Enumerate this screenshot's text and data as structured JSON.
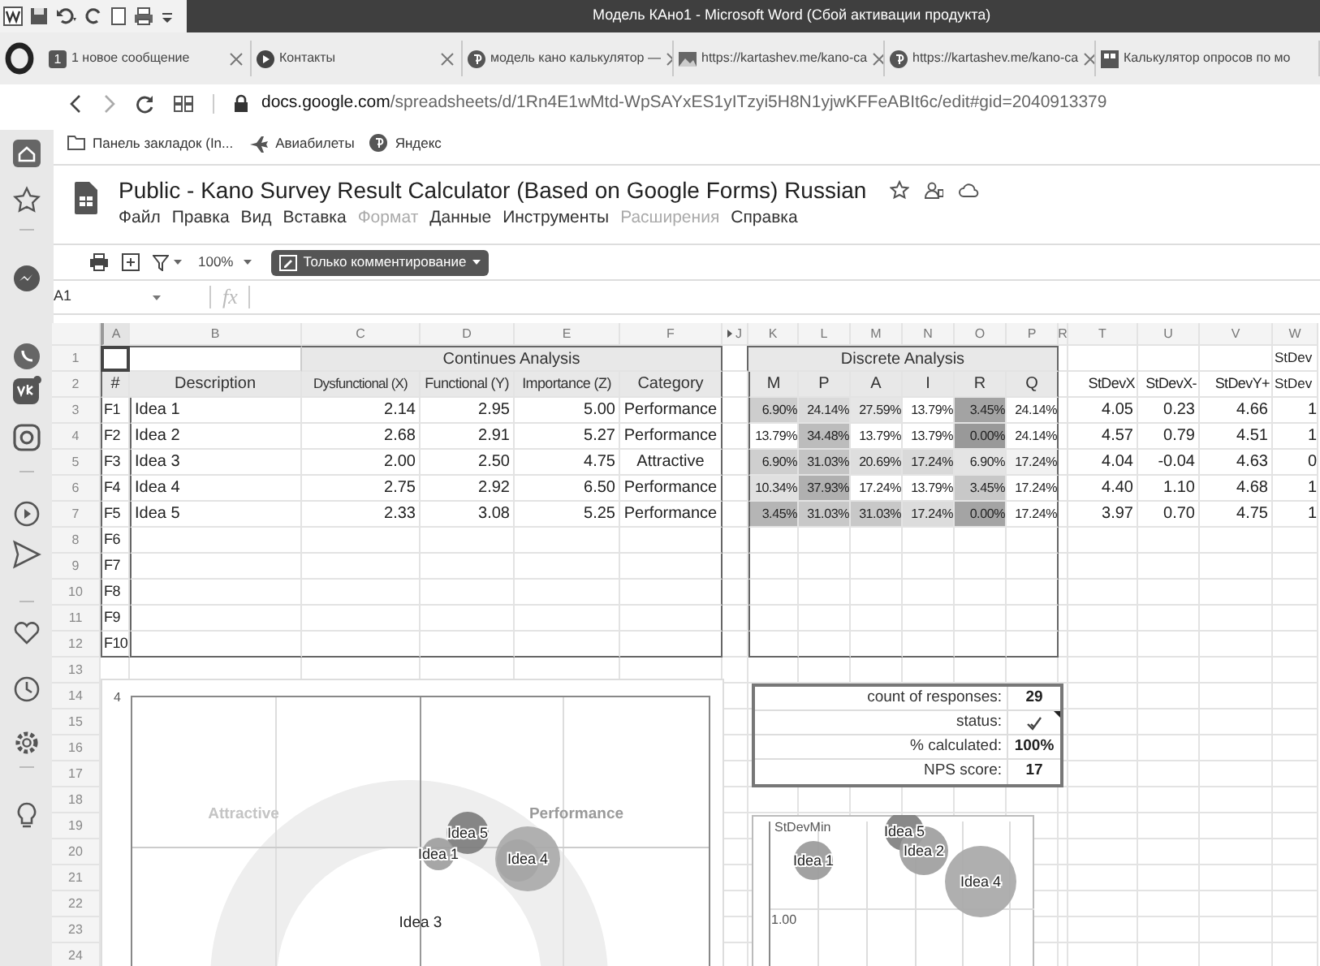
{
  "word": {
    "title": "Модель КАно1  -  Microsoft Word (Сбой активации продукта)"
  },
  "browser": {
    "tabs": [
      {
        "badge": "1",
        "label": "1 новое сообщение"
      },
      {
        "label": "Контакты"
      },
      {
        "label": "модель кано калькулятор —"
      },
      {
        "label": "https://kartashev.me/kano-ca"
      },
      {
        "label": "https://kartashev.me/kano-ca"
      },
      {
        "label": "Калькулятор опросов по мо"
      }
    ],
    "url": {
      "host": "docs.google.com",
      "path": "/spreadsheets/d/1Rn4E1wMtd-WpSAYxES1yITzyi5H8N1yjwKFFeABIt6c/edit#gid=2040913379"
    },
    "bookmarks": [
      "Панель закладок (In...",
      "Авиабилеты",
      "Яндекс"
    ]
  },
  "doc": {
    "title": "Public - Kano Survey Result Calculator (Based on Google Forms) Russian",
    "menu": [
      {
        "label": "Файл",
        "disabled": false
      },
      {
        "label": "Правка",
        "disabled": false
      },
      {
        "label": "Вид",
        "disabled": false
      },
      {
        "label": "Вставка",
        "disabled": false
      },
      {
        "label": "Формат",
        "disabled": true
      },
      {
        "label": "Данные",
        "disabled": false
      },
      {
        "label": "Инструменты",
        "disabled": false
      },
      {
        "label": "Расширения",
        "disabled": true
      },
      {
        "label": "Справка",
        "disabled": false
      }
    ],
    "zoom": "100%",
    "mode": "Только комментирование",
    "name_box": "A1",
    "fx": "fx"
  },
  "sheet": {
    "columns": [
      "A",
      "B",
      "C",
      "D",
      "E",
      "F",
      "J",
      "K",
      "L",
      "M",
      "N",
      "O",
      "P",
      "R",
      "T",
      "U",
      "V",
      "W"
    ],
    "row_numbers": [
      "1",
      "2",
      "3",
      "4",
      "5",
      "6",
      "7",
      "8",
      "9",
      "10",
      "11",
      "12",
      "13",
      "14",
      "15",
      "16",
      "17",
      "18",
      "19",
      "20",
      "21",
      "22",
      "23",
      "24"
    ],
    "continuous": {
      "title": "Continues Analysis",
      "headers": [
        "#",
        "Description",
        "Dysfunctional (X)",
        "Functional (Y)",
        "Importance (Z)",
        "Category"
      ],
      "rows": [
        {
          "id": "F1",
          "cells": [
            "Idea 1",
            "2.14",
            "2.95",
            "5.00",
            "Performance"
          ]
        },
        {
          "id": "F2",
          "cells": [
            "Idea 2",
            "2.68",
            "2.91",
            "5.27",
            "Performance"
          ]
        },
        {
          "id": "F3",
          "cells": [
            "Idea 3",
            "2.00",
            "2.50",
            "4.75",
            "Attractive"
          ]
        },
        {
          "id": "F4",
          "cells": [
            "Idea 4",
            "2.75",
            "2.92",
            "6.50",
            "Performance"
          ]
        },
        {
          "id": "F5",
          "cells": [
            "Idea 5",
            "2.33",
            "3.08",
            "5.25",
            "Performance"
          ]
        },
        {
          "id": "F6"
        },
        {
          "id": "F7"
        },
        {
          "id": "F8"
        },
        {
          "id": "F9"
        },
        {
          "id": "F10"
        }
      ]
    },
    "discrete": {
      "title": "Discrete Analysis",
      "headers": [
        "M",
        "P",
        "A",
        "I",
        "R",
        "Q"
      ],
      "rows": [
        [
          {
            "text": "6.90%",
            "color": "#cdcdcd"
          },
          {
            "text": "24.14%",
            "color": "#dadada"
          },
          {
            "text": "27.59%",
            "color": "#e6e6e6"
          },
          {
            "text": "13.79%",
            "color": "#ffffff"
          },
          {
            "text": "3.45%",
            "color": "#a3a3a3"
          },
          {
            "text": "24.14%",
            "color": "#ffffff"
          }
        ],
        [
          {
            "text": "13.79%",
            "color": "#ffffff"
          },
          {
            "text": "34.48%",
            "color": "#bcbcbc"
          },
          {
            "text": "13.79%",
            "color": "#ffffff"
          },
          {
            "text": "13.79%",
            "color": "#ffffff"
          },
          {
            "text": "0.00%",
            "color": "#999999"
          },
          {
            "text": "24.14%",
            "color": "#ffffff"
          }
        ],
        [
          {
            "text": "6.90%",
            "color": "#cfcfcf"
          },
          {
            "text": "31.03%",
            "color": "#c4c4c4"
          },
          {
            "text": "20.69%",
            "color": "#dedede"
          },
          {
            "text": "17.24%",
            "color": "#d9d9d9"
          },
          {
            "text": "6.90%",
            "color": "#e4e4e4"
          },
          {
            "text": "17.24%",
            "color": "#f2f2f2"
          }
        ],
        [
          {
            "text": "10.34%",
            "color": "#e0e0e0"
          },
          {
            "text": "37.93%",
            "color": "#b0b0b0"
          },
          {
            "text": "17.24%",
            "color": "#ffffff"
          },
          {
            "text": "13.79%",
            "color": "#ffffff"
          },
          {
            "text": "3.45%",
            "color": "#c8c8c8"
          },
          {
            "text": "17.24%",
            "color": "#ffffff"
          }
        ],
        [
          {
            "text": "3.45%",
            "color": "#b5b5b5"
          },
          {
            "text": "31.03%",
            "color": "#c8c8c8"
          },
          {
            "text": "31.03%",
            "color": "#c8c8c8"
          },
          {
            "text": "17.24%",
            "color": "#dcdcdc"
          },
          {
            "text": "0.00%",
            "color": "#a4a4a4"
          },
          {
            "text": "17.24%",
            "color": "#ffffff"
          }
        ]
      ]
    },
    "stdev": {
      "group_title": "StDev",
      "headers": [
        "StDevX",
        "StDevX-",
        "StDevY+",
        "StDev"
      ],
      "rows": [
        [
          "4.05",
          "0.23",
          "4.66",
          "1"
        ],
        [
          "4.57",
          "0.79",
          "4.51",
          "1"
        ],
        [
          "4.04",
          "-0.04",
          "4.63",
          "0"
        ],
        [
          "4.40",
          "1.10",
          "4.68",
          "1"
        ],
        [
          "3.97",
          "0.70",
          "4.75",
          "1"
        ]
      ]
    }
  },
  "summary": [
    {
      "label": "count of responses:",
      "kind": "text",
      "value": "29"
    },
    {
      "label": "status:",
      "kind": "check"
    },
    {
      "label": "% calculated:",
      "kind": "text",
      "value": "100%"
    },
    {
      "label": "NPS score:",
      "kind": "text",
      "value": "17"
    }
  ],
  "chart1": {
    "y_tick": "4",
    "quadrants": [
      "Attractive",
      "Performance"
    ],
    "bubble_labels": [
      "Idea 5",
      "Idea 1",
      "Idea 4"
    ],
    "label_only": "Idea 3"
  },
  "chart2": {
    "title": "StDevMin",
    "y_tick": "1.00",
    "bubble_labels": [
      "Idea 1",
      "Idea 5",
      "Idea 2",
      "Idea 4"
    ]
  }
}
